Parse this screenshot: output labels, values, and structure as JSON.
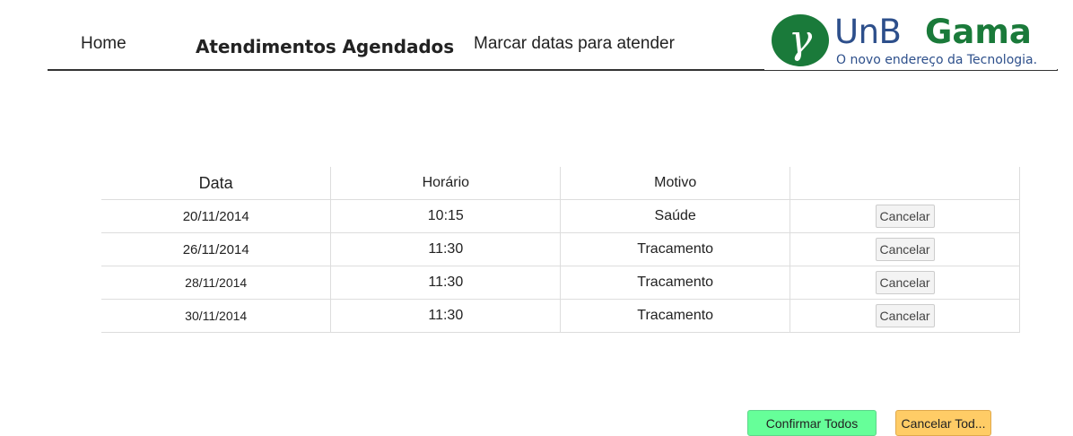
{
  "nav": {
    "home": "Home",
    "appointments": "Atendimentos Agendados",
    "mark_dates": "Marcar datas para atender"
  },
  "logo": {
    "symbol": "γ",
    "unb": "UnB",
    "gama": "Gama",
    "tagline": "O novo endereço da Tecnologia.",
    "colors": {
      "green": "#1a7a3a",
      "blue": "#2d4f8b"
    }
  },
  "table": {
    "headers": [
      "Data",
      "Horário",
      "Motivo",
      ""
    ],
    "rows": [
      {
        "date": "20/11/2014",
        "time": "10:15",
        "reason": "Saúde",
        "action": "Cancelar"
      },
      {
        "date": "26/11/2014",
        "time": "11:30",
        "reason": "Tracamento",
        "action": "Cancelar"
      },
      {
        "date": "28/11/2014",
        "time": "11:30",
        "reason": "Tracamento",
        "action": "Cancelar"
      },
      {
        "date": "30/11/2014",
        "time": "11:30",
        "reason": "Tracamento",
        "action": "Cancelar"
      }
    ]
  },
  "actions": {
    "confirm_all": "Confirmar Todos",
    "cancel_all": "Cancelar Tod...",
    "colors": {
      "confirm": "#66ff99",
      "cancel": "#ffcc66"
    }
  }
}
